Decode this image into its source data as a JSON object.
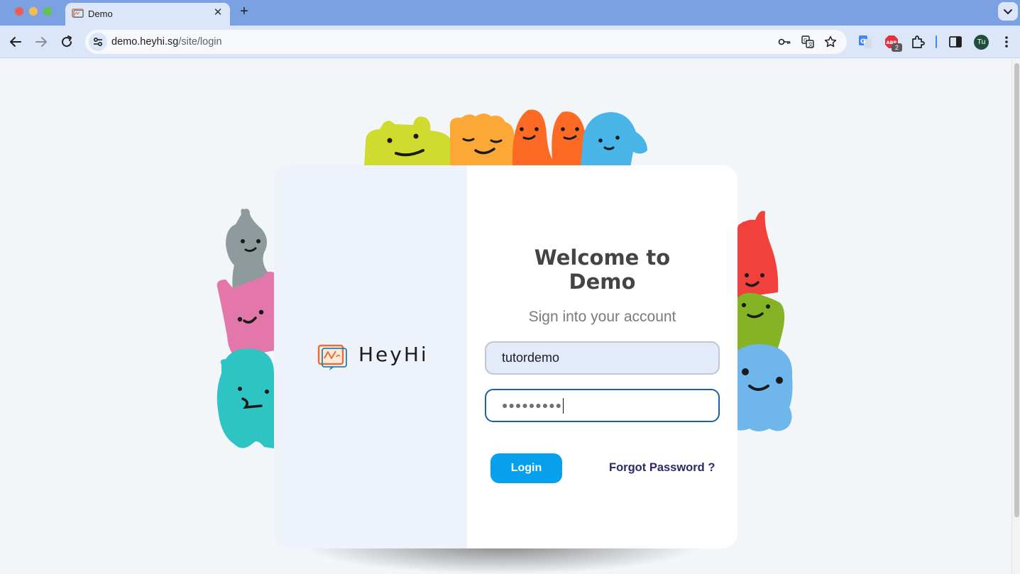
{
  "browser": {
    "tab_title": "Demo",
    "url_host": "demo.heyhi.sg",
    "url_path": "/site/login",
    "extension_badge": "2",
    "profile_initials": "Tu",
    "icons": [
      "back-arrow-icon",
      "forward-arrow-icon",
      "reload-icon",
      "site-settings-icon",
      "password-key-icon",
      "translate-icon",
      "bookmark-star-icon",
      "google-translate-extension-icon",
      "adblock-extension-icon",
      "extensions-puzzle-icon",
      "side-panel-icon",
      "more-menu-icon"
    ]
  },
  "login": {
    "brand_name": "HeyHi",
    "welcome_line1": "Welcome to",
    "welcome_line2": "Demo",
    "subtitle": "Sign into your account",
    "username_value": "tutordemo",
    "password_mask": "●●●●●●●●●",
    "login_label": "Login",
    "forgot_label": "Forgot Password ?"
  },
  "colors": {
    "accent": "#06a0ec",
    "link": "#2a2a6a",
    "card_left": "#edf2fb",
    "page_bg": "#f3f6f9",
    "tab_strip": "#7ba1e2"
  }
}
